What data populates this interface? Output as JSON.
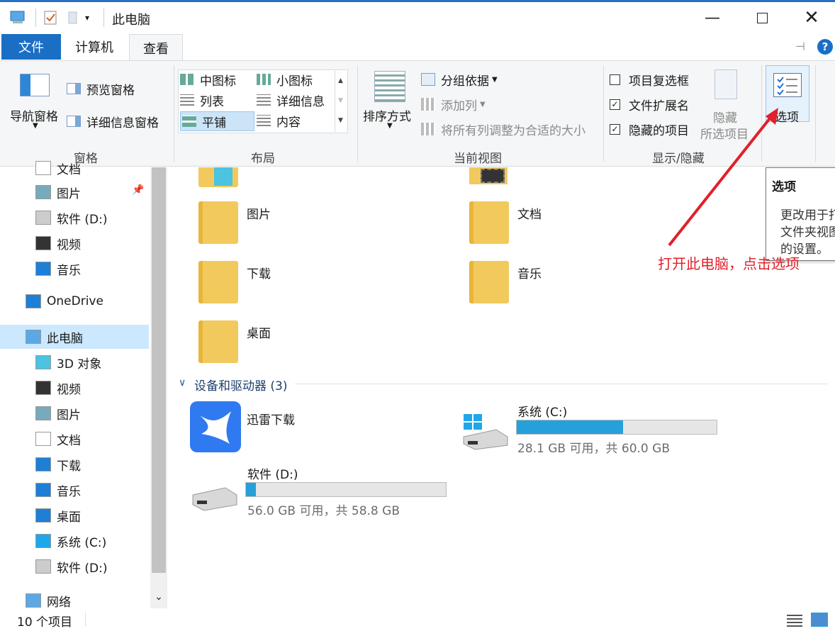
{
  "window": {
    "title": "此电脑"
  },
  "tabs": {
    "file": "文件",
    "computer": "计算机",
    "view": "查看"
  },
  "ribbon": {
    "pane": {
      "nav_pane": "导航窗格",
      "preview_pane": "预览窗格",
      "details_pane": "详细信息窗格",
      "label": "窗格"
    },
    "layout": {
      "medium_icons": "中图标",
      "small_icons": "小图标",
      "list": "列表",
      "details": "详细信息",
      "tiles": "平铺",
      "content": "内容",
      "label": "布局"
    },
    "current_view": {
      "sort_by": "排序方式",
      "group_by": "分组依据",
      "add_columns": "添加列",
      "fit_columns": "将所有列调整为合适的大小",
      "label": "当前视图"
    },
    "show_hide": {
      "item_checkboxes": "项目复选框",
      "file_extensions": "文件扩展名",
      "hidden_items": "隐藏的项目",
      "hide_selected_1": "隐藏",
      "hide_selected_2": "所选项目",
      "label": "显示/隐藏",
      "item_checkboxes_checked": false,
      "file_extensions_checked": true,
      "hidden_items_checked": true
    },
    "options": {
      "label": "选项"
    }
  },
  "nav": {
    "items": [
      {
        "label": "文档"
      },
      {
        "label": "图片"
      },
      {
        "label": "软件 (D:)"
      },
      {
        "label": "视频"
      },
      {
        "label": "音乐"
      },
      {
        "label": "OneDrive"
      },
      {
        "label": "此电脑"
      },
      {
        "label": "3D 对象"
      },
      {
        "label": "视频"
      },
      {
        "label": "图片"
      },
      {
        "label": "文档"
      },
      {
        "label": "下载"
      },
      {
        "label": "音乐"
      },
      {
        "label": "桌面"
      },
      {
        "label": "系统 (C:)"
      },
      {
        "label": "软件 (D:)"
      },
      {
        "label": "网络"
      }
    ]
  },
  "folders": [
    {
      "name": "图片"
    },
    {
      "name": "文档"
    },
    {
      "name": "下载"
    },
    {
      "name": "音乐"
    },
    {
      "name": "桌面"
    }
  ],
  "devices": {
    "header": "设备和驱动器 (3)",
    "xunlei": {
      "name": "迅雷下载"
    },
    "system_c": {
      "name": "系统 (C:)",
      "free_text": "28.1 GB 可用，共 60.0 GB",
      "used_fraction": 0.532
    },
    "soft_d": {
      "name": "软件 (D:)",
      "free_text": "56.0 GB 可用，共 58.8 GB",
      "used_fraction": 0.048
    }
  },
  "status": {
    "count": "10 个项目"
  },
  "tooltip": {
    "title": "选项",
    "line1": "更改用于打",
    "line2": "文件夹视图",
    "line3": "的设置。"
  },
  "annotation": {
    "text": "打开此电脑，点击选项",
    "color": "#e0202a"
  }
}
